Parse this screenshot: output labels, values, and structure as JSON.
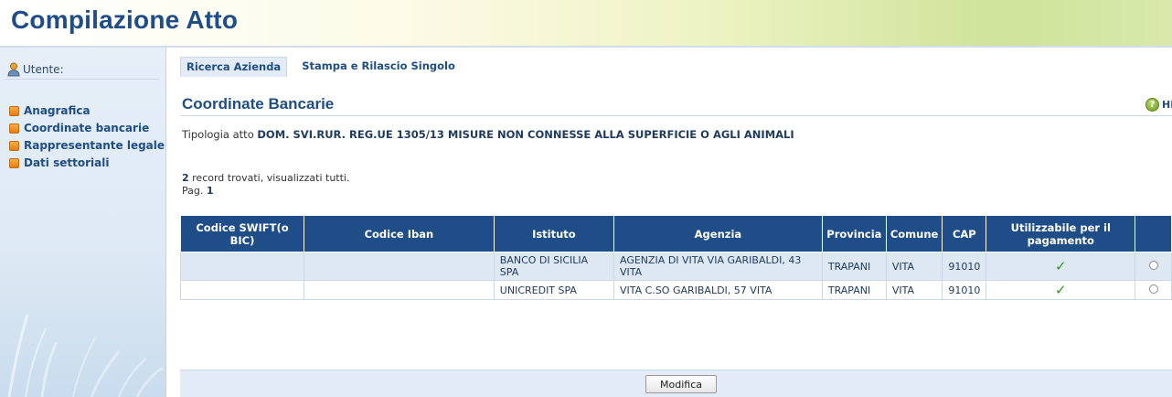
{
  "header": {
    "title": "Compilazione Atto"
  },
  "sidebar": {
    "user_label": "Utente:",
    "menu": [
      {
        "label": "Anagrafica"
      },
      {
        "label": "Coordinate bancarie"
      },
      {
        "label": "Rappresentante legale"
      },
      {
        "label": "Dati settoriali"
      }
    ]
  },
  "tabs": [
    {
      "label": "Ricerca Azienda",
      "active": true
    },
    {
      "label": "Stampa e Rilascio Singolo",
      "active": false
    }
  ],
  "section": {
    "title": "Coordinate Bancarie",
    "help_label": "HELI"
  },
  "tipologia": {
    "label": "Tipologia atto",
    "value": "DOM. SVI.RUR. REG.UE 1305/13 MISURE NON CONNESSE ALLA SUPERFICIE O AGLI ANIMALI"
  },
  "records": {
    "count": "2",
    "text": "record trovati, visualizzati tutti.",
    "page_label": "Pag.",
    "page_number": "1"
  },
  "table": {
    "headers": [
      "Codice SWIFT(o BIC)",
      "Codice Iban",
      "Istituto",
      "Agenzia",
      "Provincia",
      "Comune",
      "CAP",
      "Utilizzabile per il pagamento",
      ""
    ],
    "rows": [
      {
        "swift": "",
        "iban": "",
        "istituto": "BANCO DI SICILIA SPA",
        "agenzia": "AGENZIA DI VITA VIA GARIBALDI, 43 VITA",
        "provincia": "TRAPANI",
        "comune": "VITA",
        "cap": "91010",
        "utilizzabile": "✓"
      },
      {
        "swift": "",
        "iban": "",
        "istituto": "UNICREDIT SPA",
        "agenzia": "VITA C.SO GARIBALDI, 57 VITA",
        "provincia": "TRAPANI",
        "comune": "VITA",
        "cap": "91010",
        "utilizzabile": "✓"
      }
    ]
  },
  "footer": {
    "button_label": "Modifica"
  },
  "colors": {
    "header_text": "#1e4d87",
    "table_header_bg": "#1e4d87",
    "row_alt_bg": "#dde8f3",
    "bullet": "#e47b12",
    "check": "#2a9a1a"
  }
}
